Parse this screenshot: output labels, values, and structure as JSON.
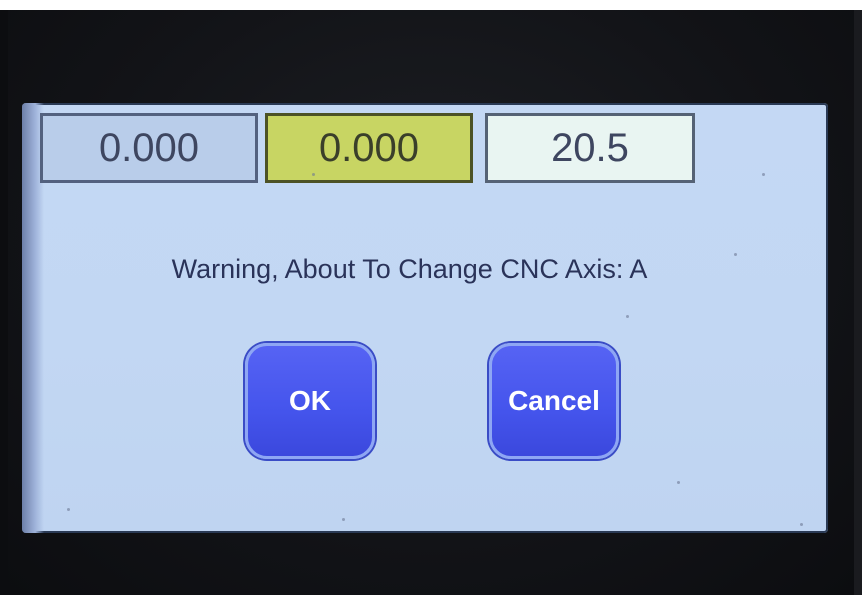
{
  "display": {
    "values": [
      "0.000",
      "0.000",
      "20.5"
    ]
  },
  "dialog": {
    "message": "Warning, About To Change CNC Axis: A",
    "ok_label": "OK",
    "cancel_label": "Cancel"
  },
  "colors": {
    "screen_background": "#c4d8f4",
    "highlight_value_box": "#c8d563",
    "button_blue": "#4454ec",
    "text_dark": "#2a3359"
  }
}
